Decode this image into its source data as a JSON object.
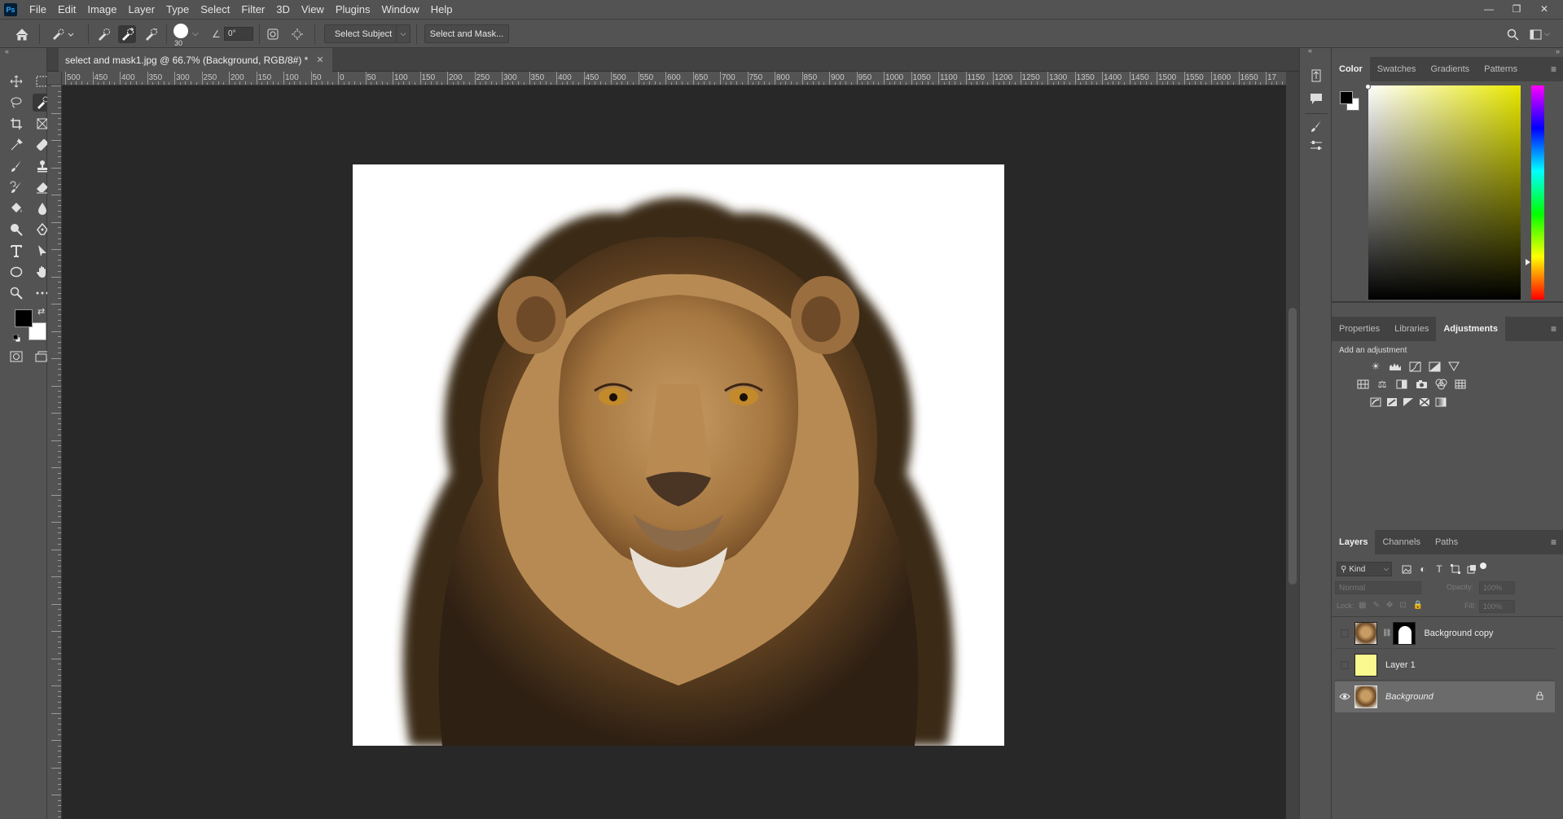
{
  "app": {
    "logo": "Ps"
  },
  "menu": [
    "File",
    "Edit",
    "Image",
    "Layer",
    "Type",
    "Select",
    "Filter",
    "3D",
    "View",
    "Plugins",
    "Window",
    "Help"
  ],
  "window_controls": {
    "minimize": "—",
    "restore": "❐",
    "close": "✕"
  },
  "options": {
    "brush_size": "30",
    "angle": "0°",
    "select_subject": "Select Subject",
    "select_and_mask": "Select and Mask..."
  },
  "document": {
    "tab_title": "select and mask1.jpg @ 66.7% (Background, RGB/8#) *",
    "close": "✕"
  },
  "ruler": {
    "labels": [
      "500",
      "450",
      "400",
      "350",
      "300",
      "250",
      "200",
      "150",
      "100",
      "50",
      "0",
      "50",
      "100",
      "150",
      "200",
      "250",
      "300",
      "350",
      "400",
      "450",
      "500",
      "550",
      "600",
      "650",
      "700",
      "750",
      "800",
      "850",
      "900",
      "950",
      "1000",
      "1050",
      "1100",
      "1150",
      "1200",
      "1250",
      "1300",
      "1350",
      "1400",
      "1450",
      "1500",
      "1550",
      "1600",
      "1650",
      "17"
    ]
  },
  "color_panel": {
    "tabs": [
      "Color",
      "Swatches",
      "Gradients",
      "Patterns"
    ],
    "active_tab": "Color",
    "foreground": "#000000",
    "background": "#ffffff",
    "hue_color": "#e8e800"
  },
  "adjustments_panel": {
    "tabs": [
      "Properties",
      "Libraries",
      "Adjustments"
    ],
    "active_tab": "Adjustments",
    "heading": "Add an adjustment"
  },
  "layers_panel": {
    "tabs": [
      "Layers",
      "Channels",
      "Paths"
    ],
    "active_tab": "Layers",
    "filter_kind": "Kind",
    "blend_mode": "Normal",
    "opacity_label": "Opacity:",
    "opacity_value": "100%",
    "lock_label": "Lock:",
    "fill_label": "Fill:",
    "fill_value": "100%",
    "layers": [
      {
        "name": "Background copy",
        "visible": false,
        "thumb_color": "#8a6334",
        "has_mask": true
      },
      {
        "name": "Layer 1",
        "visible": false,
        "thumb_color": "#f9f98f"
      },
      {
        "name": "Background",
        "visible": true,
        "thumb_color": "#8a6334",
        "locked": true,
        "selected": true
      }
    ]
  }
}
